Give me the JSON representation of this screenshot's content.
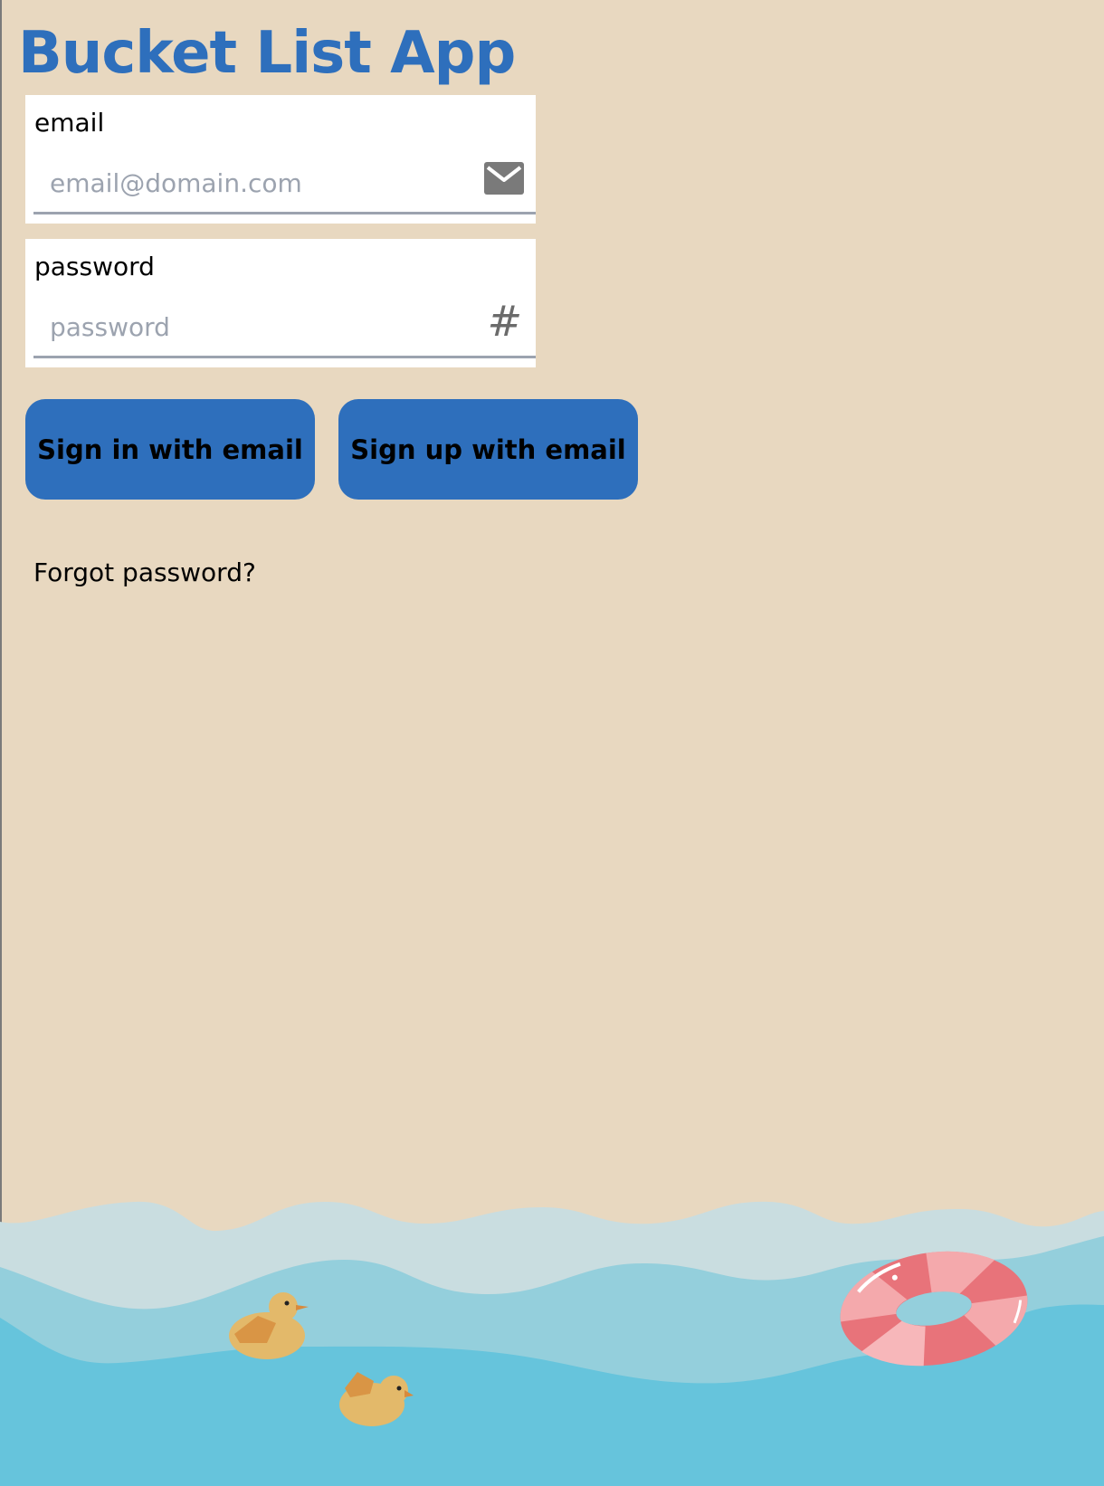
{
  "app": {
    "title": "Bucket List App"
  },
  "email_field": {
    "label": "email",
    "placeholder": "email@domain.com",
    "value": "",
    "icon": "mail-icon"
  },
  "password_field": {
    "label": "password",
    "placeholder": "password",
    "value": "",
    "icon": "hash-icon",
    "icon_glyph": "#"
  },
  "actions": {
    "sign_in_label": "Sign in with email",
    "sign_up_label": "Sign up with email",
    "forgot_label": "Forgot password?"
  },
  "colors": {
    "background": "#e8d8c0",
    "accent": "#2e6fbc",
    "water_light": "#c9dde0",
    "water_mid": "#94cfdc",
    "water_deep": "#66c4dc",
    "duck": "#e3b96a",
    "ring_red": "#e8737a",
    "ring_pink": "#f4a9ac"
  }
}
